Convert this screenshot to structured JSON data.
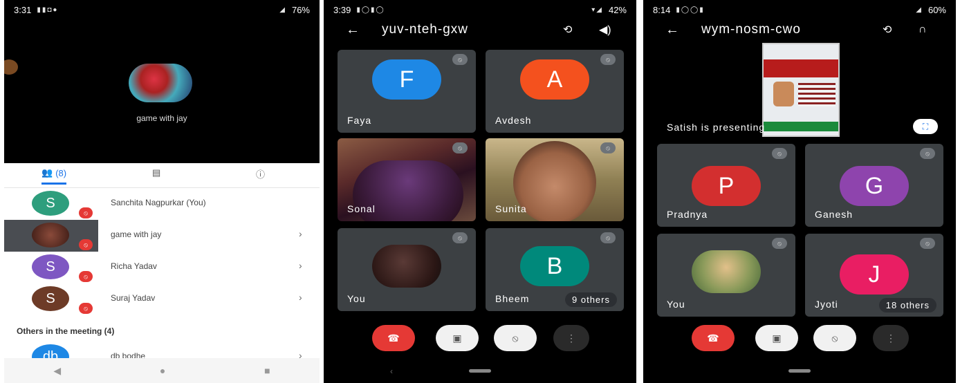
{
  "phone1": {
    "status": {
      "time": "3:31",
      "battery": "76%"
    },
    "stage_name": "game with jay",
    "tabs": {
      "people": "(8)"
    },
    "participants": [
      {
        "initial": "S",
        "name": "Sanchita Nagpurkar (You)",
        "color": "#2e9e7d"
      },
      {
        "initial": "",
        "name": "game with jay",
        "color": "#7a3a30"
      },
      {
        "initial": "S",
        "name": "Richa Yadav",
        "color": "#7e57c2"
      },
      {
        "initial": "S",
        "name": "Suraj Yadav",
        "color": "#6d3b27"
      },
      {
        "initial": "db",
        "name": "db bodhe",
        "color": "#1e88e5"
      }
    ],
    "others_title": "Others in the meeting (4)"
  },
  "phone2": {
    "status": {
      "time": "3:39",
      "battery": "42%"
    },
    "meeting_code": "yuv-nteh-gxw",
    "tiles": [
      {
        "name": "Faya",
        "initial": "F",
        "color": "#1e88e5"
      },
      {
        "name": "Avdesh",
        "initial": "A",
        "color": "#f4511e"
      },
      {
        "name": "Sonal",
        "initial": ""
      },
      {
        "name": "Sunita",
        "initial": ""
      },
      {
        "name": "You",
        "initial": ""
      },
      {
        "name": "Bheem",
        "initial": "B",
        "color": "#00897b",
        "others": "9 others"
      }
    ]
  },
  "phone3": {
    "status": {
      "time": "8:14",
      "battery": "60%"
    },
    "meeting_code": "wym-nosm-cwo",
    "presenting": "Satish is presenting",
    "tiles": [
      {
        "name": "Pradnya",
        "initial": "P",
        "color": "#d32f2f"
      },
      {
        "name": "Ganesh",
        "initial": "G",
        "color": "#8e44ad"
      },
      {
        "name": "You",
        "initial": ""
      },
      {
        "name": "Jyoti",
        "initial": "J",
        "color": "#e91e63",
        "others": "18 others"
      }
    ]
  }
}
